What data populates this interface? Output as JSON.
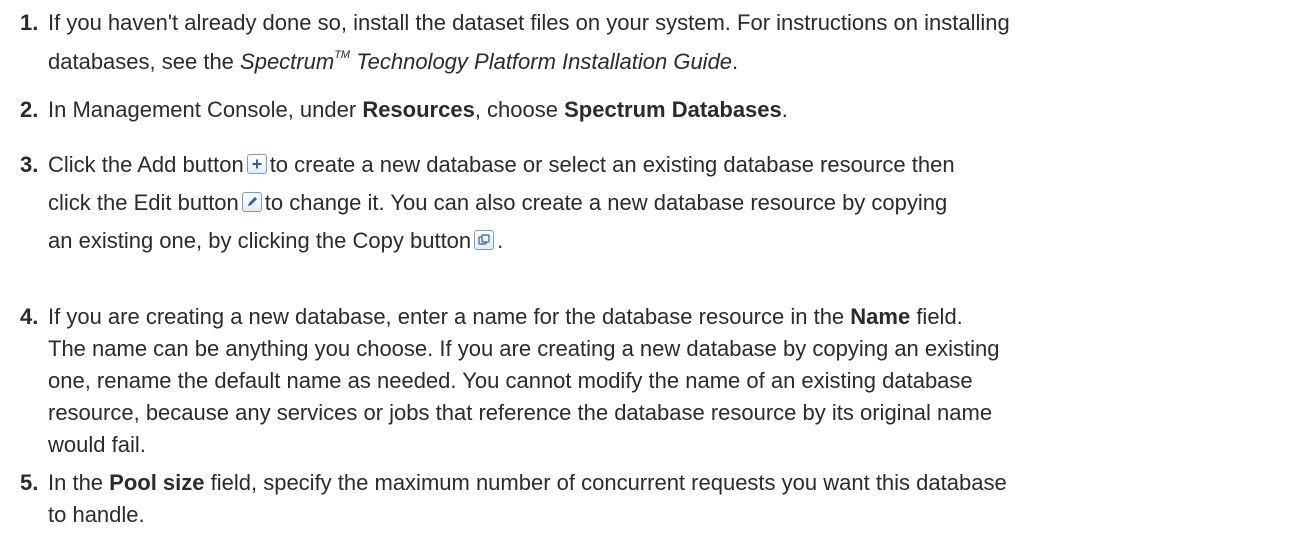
{
  "steps": [
    {
      "number": "1.",
      "line1": "If you haven't already done so, install the dataset files on your system. For instructions on installing",
      "line2_a": "databases, see the ",
      "guide_title": "Spectrum",
      "trademark": "TM",
      "guide_rest": " Technology Platform Installation Guide",
      "line2_end": "."
    },
    {
      "number": "2.",
      "text_a": "In Management Console, under ",
      "resources": "Resources",
      "text_b": ", choose ",
      "databases": "Spectrum Databases",
      "text_c": "."
    },
    {
      "number": "3.",
      "text_a": "Click the Add button",
      "text_b": "to create a new database or select an existing database resource then",
      "text_c": "click the Edit button",
      "text_d": "to change it. You can also create a new database resource by copying",
      "text_e": "an existing one, by clicking the Copy button",
      "text_f": "."
    },
    {
      "number": "4.",
      "text_a": "If you are creating a new database, enter a name for the database resource in the ",
      "name_field": "Name",
      "text_b": " field.",
      "line2": "The name can be anything you choose. If you are creating a new database by copying an existing",
      "line3": "one, rename the default name as needed. You cannot modify the name of an existing database",
      "line4": "resource, because any services or jobs that reference the database resource by its original name",
      "line5": "would fail."
    },
    {
      "number": "5.",
      "text_a": "In the ",
      "pool_field": "Pool size",
      "text_b": " field, specify the maximum number of concurrent requests you want this database",
      "line2": "to handle."
    }
  ],
  "icons": {
    "add": "plus-icon",
    "edit": "pencil-icon",
    "copy": "copy-icon"
  },
  "colors": {
    "text": "#2b2b2b",
    "icon_border": "#7a9ec9",
    "icon_glyph": "#2f5f9e"
  }
}
